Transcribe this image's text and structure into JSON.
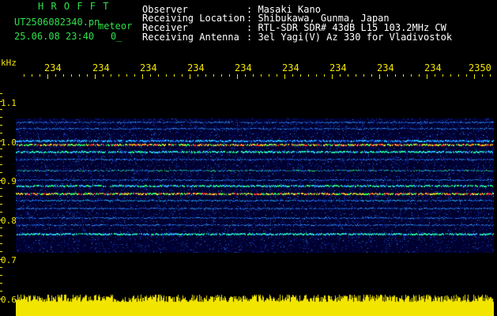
{
  "header": {
    "brand": "H R O F F T",
    "filename": "UT2506082340.pn",
    "mode": "meteor",
    "datetime": "25.06.08 23:40",
    "flag": "0_",
    "fields": [
      {
        "label": "Observer",
        "value": ": Masaki Kano"
      },
      {
        "label": "Receiving Location",
        "value": ": Shibukawa, Gunma, Japan"
      },
      {
        "label": "Receiver",
        "value": ": RTL-SDR SDR# 43dB L15 103.2MHz CW"
      },
      {
        "label": "Receiving Antenna",
        "value": ": 3el Yagi(V) Az 330 for Vladivostok"
      }
    ]
  },
  "axes": {
    "yunit": "kHz",
    "yticks": [
      "1.1",
      "1.0",
      "0.9",
      "0.8",
      "0.7",
      "0.6"
    ],
    "xticks": [
      "234",
      "234",
      "234",
      "234",
      "234",
      "234",
      "234",
      "234",
      "234",
      "2350"
    ]
  },
  "colors": {
    "accent_text": "#f2e600",
    "brand": "#2fe04a",
    "background": "#000000",
    "spectrum_bg": "#000033"
  }
}
